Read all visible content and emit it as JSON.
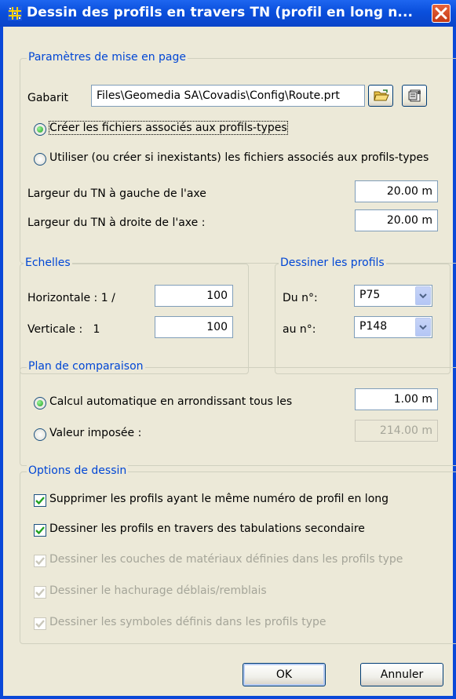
{
  "window": {
    "title": "Dessin des profils en travers TN (profil en long n...",
    "close_icon": "close-icon"
  },
  "layout_section": {
    "legend": "Paramètres de mise en page",
    "gabarit_label": "Gabarit",
    "gabarit_value": "Files\\Geomedia SA\\Covadis\\Config\\Route.prt",
    "open_icon": "folder-open-icon",
    "properties_icon": "properties-icon",
    "radio_create_label": "Créer les fichiers associés aux profils-types",
    "radio_create_checked": true,
    "radio_use_label": "Utiliser (ou créer si inexistants) les fichiers associés aux profils-types",
    "radio_use_checked": false,
    "left_width_label": "Largeur du TN à gauche de l'axe",
    "left_width_value": "20.00 m",
    "right_width_label": "Largeur du TN à droite de l'axe :",
    "right_width_value": "20.00 m"
  },
  "scales": {
    "legend": "Echelles",
    "horizontal_label": "Horizontale : 1 /",
    "horizontal_value": "100",
    "vertical_label": "Verticale :   1",
    "vertical_value": "100"
  },
  "draw_profiles": {
    "legend": "Dessiner les profils",
    "from_label": "Du n°:",
    "from_value": "P75",
    "to_label": "au n°:",
    "to_value": "P148"
  },
  "comparison_plane": {
    "legend": "Plan de comparaison",
    "auto_label": "Calcul automatique en arrondissant tous les",
    "auto_checked": true,
    "auto_value": "1.00 m",
    "imposed_label": "Valeur imposée :",
    "imposed_checked": false,
    "imposed_value": "214.00 m"
  },
  "drawing_options": {
    "legend": "Options de dessin",
    "items": [
      {
        "label": "Supprimer les profils ayant le même numéro de profil en long",
        "checked": true,
        "enabled": true
      },
      {
        "label": "Dessiner les profils en travers des tabulations secondaire",
        "checked": true,
        "enabled": true
      },
      {
        "label": "Dessiner les couches de matériaux définies dans les profils type",
        "checked": true,
        "enabled": false
      },
      {
        "label": "Dessiner le hachurage déblais/remblais",
        "checked": true,
        "enabled": false
      },
      {
        "label": "Dessiner les symboles définis dans les profils type",
        "checked": true,
        "enabled": false
      }
    ]
  },
  "buttons": {
    "ok": "OK",
    "cancel": "Annuler"
  },
  "colors": {
    "titlebar": "#0a4fdc",
    "dialog_bg": "#ece9d8",
    "group_legend": "#0046d5",
    "close_button": "#c43a16"
  }
}
